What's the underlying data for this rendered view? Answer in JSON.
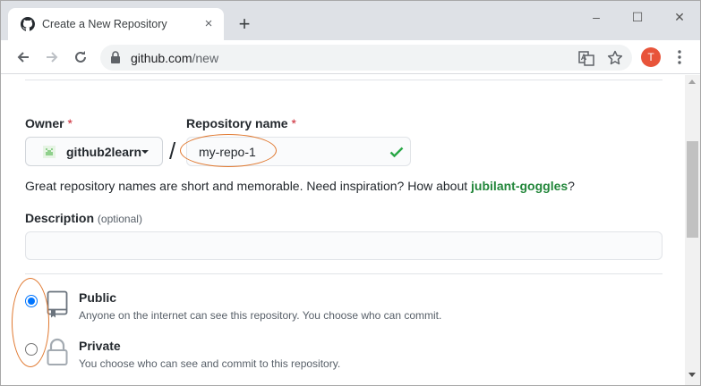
{
  "browser": {
    "tab_title": "Create a New Repository",
    "tab_close": "×",
    "new_tab": "+",
    "window_controls": {
      "minimize": "–",
      "maximize": "☐",
      "close": "✕"
    },
    "url_host": "github.com",
    "url_path": "/new",
    "profile_initial": "T",
    "icons": [
      "github-favicon-icon",
      "back-arrow-icon",
      "forward-arrow-icon",
      "reload-icon",
      "lock-icon",
      "translate-icon",
      "star-icon",
      "kebab-menu-icon"
    ]
  },
  "form": {
    "owner_label": "Owner",
    "required_mark": "*",
    "owner_value": "github2learn",
    "separator": "/",
    "repo_label": "Repository name",
    "repo_value": "my-repo-1",
    "hint_text": "Great repository names are short and memorable. Need inspiration? How about ",
    "hint_suggestion": "jubilant-goggles",
    "hint_end": "?",
    "description_label": "Description",
    "description_optional": "(optional)",
    "description_value": ""
  },
  "visibility": {
    "selected": "public",
    "options": [
      {
        "title": "Public",
        "description": "Anyone on the internet can see this repository. You choose who can commit."
      },
      {
        "title": "Private",
        "description": "You choose who can see and commit to this repository."
      }
    ]
  },
  "colors": {
    "annotation": "#e0782f",
    "link_green": "#22863a",
    "required_red": "#cb2431",
    "radio_blue": "#0075ff",
    "avatar": "#e8543a"
  }
}
